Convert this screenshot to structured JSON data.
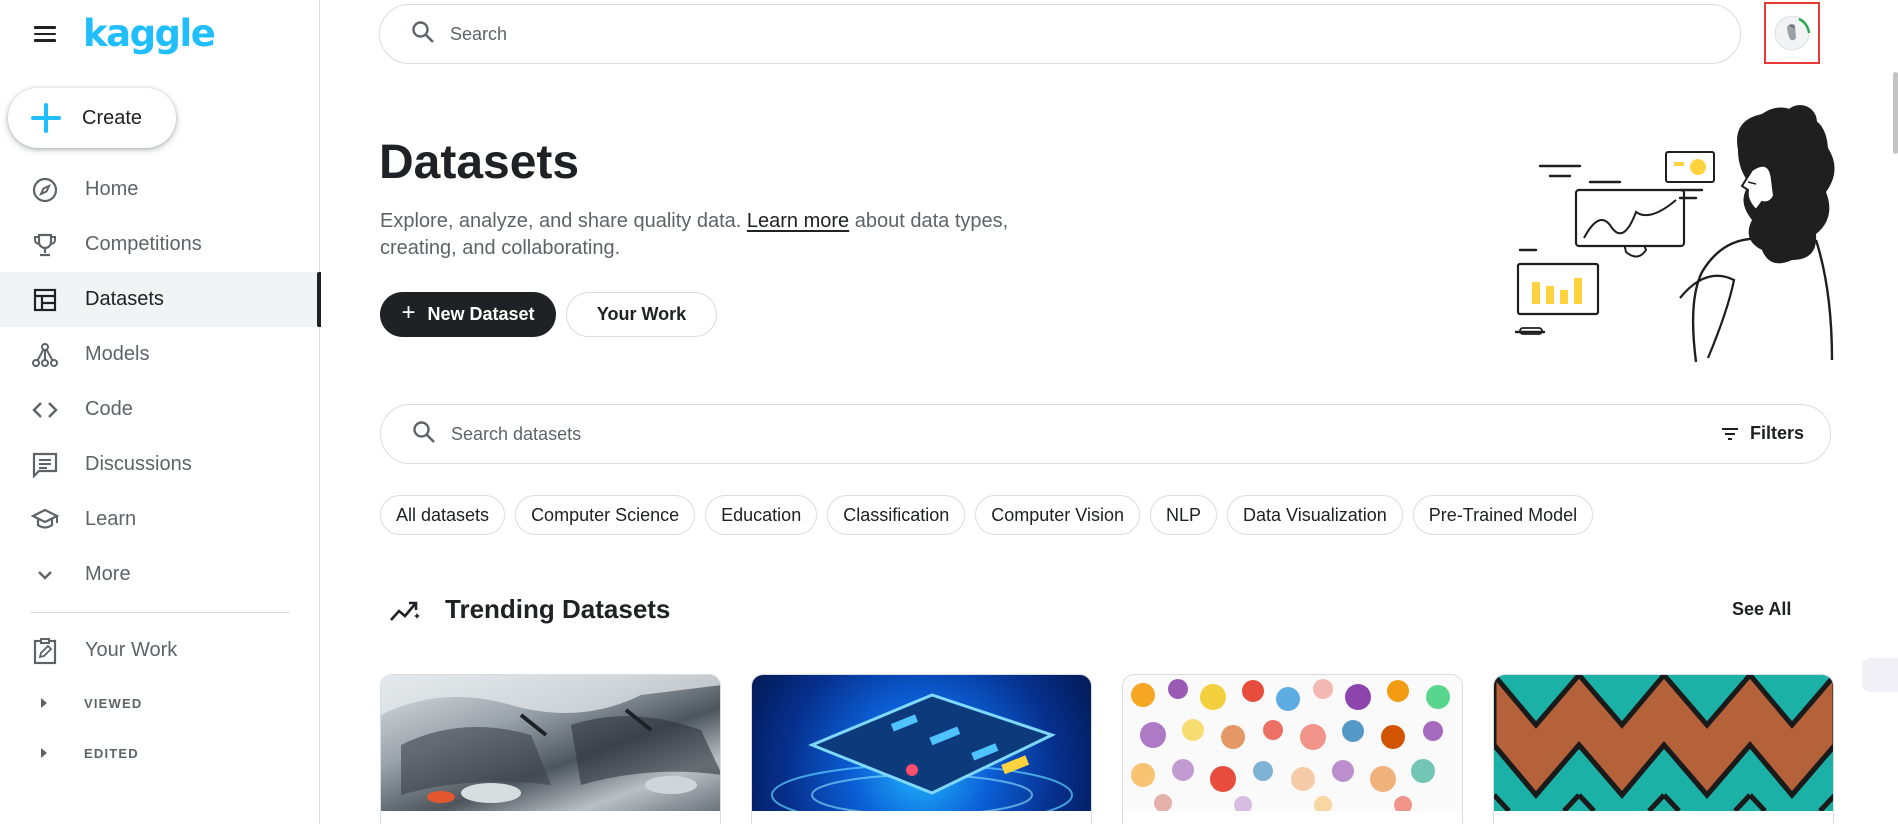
{
  "brand": {
    "logo_text": "kaggle",
    "accent": "#20beff"
  },
  "sidebar": {
    "create_label": "Create",
    "items": [
      {
        "label": "Home",
        "icon": "compass-icon"
      },
      {
        "label": "Competitions",
        "icon": "trophy-icon"
      },
      {
        "label": "Datasets",
        "icon": "table-icon",
        "active": true
      },
      {
        "label": "Models",
        "icon": "models-icon"
      },
      {
        "label": "Code",
        "icon": "code-icon"
      },
      {
        "label": "Discussions",
        "icon": "discussion-icon"
      },
      {
        "label": "Learn",
        "icon": "school-icon"
      },
      {
        "label": "More",
        "icon": "chevron-down-icon"
      }
    ],
    "your_work_label": "Your Work",
    "viewed_label": "VIEWED",
    "edited_label": "EDITED"
  },
  "header": {
    "search_placeholder": "Search"
  },
  "hero": {
    "title": "Datasets",
    "desc_before": "Explore, analyze, and share quality data. ",
    "desc_link": "Learn more",
    "desc_after": " about data types, creating, and collaborating.",
    "new_dataset_label": "New Dataset",
    "your_work_label": "Your Work"
  },
  "dataset_search": {
    "placeholder": "Search datasets",
    "filters_label": "Filters"
  },
  "chips": [
    "All datasets",
    "Computer Science",
    "Education",
    "Classification",
    "Computer Vision",
    "NLP",
    "Data Visualization",
    "Pre-Trained Model"
  ],
  "trending": {
    "title": "Trending Datasets",
    "see_all_label": "See All",
    "cards": [
      {
        "thumb": "cars"
      },
      {
        "thumb": "phone"
      },
      {
        "thumb": "pokemon"
      },
      {
        "thumb": "chevron-pattern"
      }
    ]
  }
}
